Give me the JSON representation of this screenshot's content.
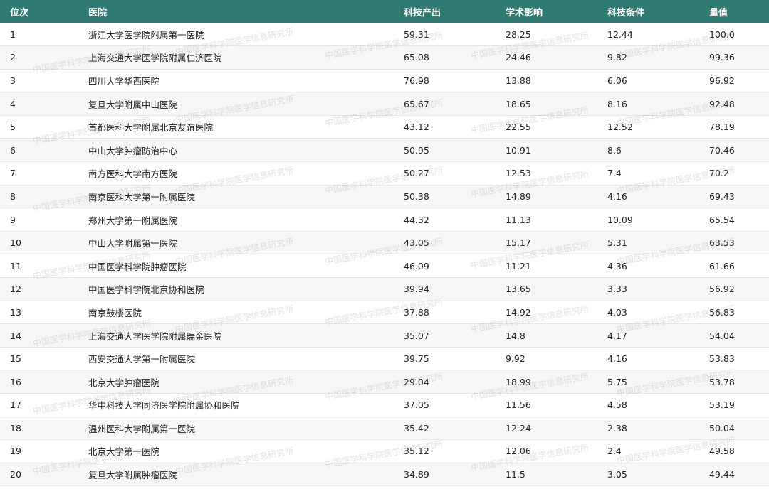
{
  "table": {
    "headers": [
      "位次",
      "医院",
      "科技产出",
      "学术影响",
      "科技条件",
      "量值"
    ],
    "rows": [
      [
        "1",
        "浙江大学医学院附属第一医院",
        "59.31",
        "28.25",
        "12.44",
        "100.0"
      ],
      [
        "2",
        "上海交通大学医学院附属仁济医院",
        "65.08",
        "24.46",
        "9.82",
        "99.36"
      ],
      [
        "3",
        "四川大学华西医院",
        "76.98",
        "13.88",
        "6.06",
        "96.92"
      ],
      [
        "4",
        "复旦大学附属中山医院",
        "65.67",
        "18.65",
        "8.16",
        "92.48"
      ],
      [
        "5",
        "首都医科大学附属北京友谊医院",
        "43.12",
        "22.55",
        "12.52",
        "78.19"
      ],
      [
        "6",
        "中山大学肿瘤防治中心",
        "50.95",
        "10.91",
        "8.6",
        "70.46"
      ],
      [
        "7",
        "南方医科大学南方医院",
        "50.27",
        "12.53",
        "7.4",
        "70.2"
      ],
      [
        "8",
        "南京医科大学第一附属医院",
        "50.38",
        "14.89",
        "4.16",
        "69.43"
      ],
      [
        "9",
        "郑州大学第一附属医院",
        "44.32",
        "11.13",
        "10.09",
        "65.54"
      ],
      [
        "10",
        "中山大学附属第一医院",
        "43.05",
        "15.17",
        "5.31",
        "63.53"
      ],
      [
        "11",
        "中国医学科学院肿瘤医院",
        "46.09",
        "11.21",
        "4.36",
        "61.66"
      ],
      [
        "12",
        "中国医学科学院北京协和医院",
        "39.94",
        "13.65",
        "3.33",
        "56.92"
      ],
      [
        "13",
        "南京鼓楼医院",
        "37.88",
        "14.92",
        "4.03",
        "56.83"
      ],
      [
        "14",
        "上海交通大学医学院附属瑞金医院",
        "35.07",
        "14.8",
        "4.17",
        "54.04"
      ],
      [
        "15",
        "西安交通大学第一附属医院",
        "39.75",
        "9.92",
        "4.16",
        "53.83"
      ],
      [
        "16",
        "北京大学肿瘤医院",
        "29.04",
        "18.99",
        "5.75",
        "53.78"
      ],
      [
        "17",
        "华中科技大学同济医学院附属协和医院",
        "37.05",
        "11.56",
        "4.58",
        "53.19"
      ],
      [
        "18",
        "温州医科大学附属第一医院",
        "35.42",
        "12.24",
        "2.38",
        "50.04"
      ],
      [
        "19",
        "北京大学第一医院",
        "35.12",
        "12.06",
        "2.4",
        "49.58"
      ],
      [
        "20",
        "复旦大学附属肿瘤医院",
        "34.89",
        "11.5",
        "3.05",
        "49.44"
      ]
    ]
  },
  "watermark": {
    "text": "中国医学科学院医学信息研究所"
  },
  "colors": {
    "header_bg": "#2f7a73",
    "header_text": "#ffffff",
    "row_alt": "#f7f7f7"
  }
}
